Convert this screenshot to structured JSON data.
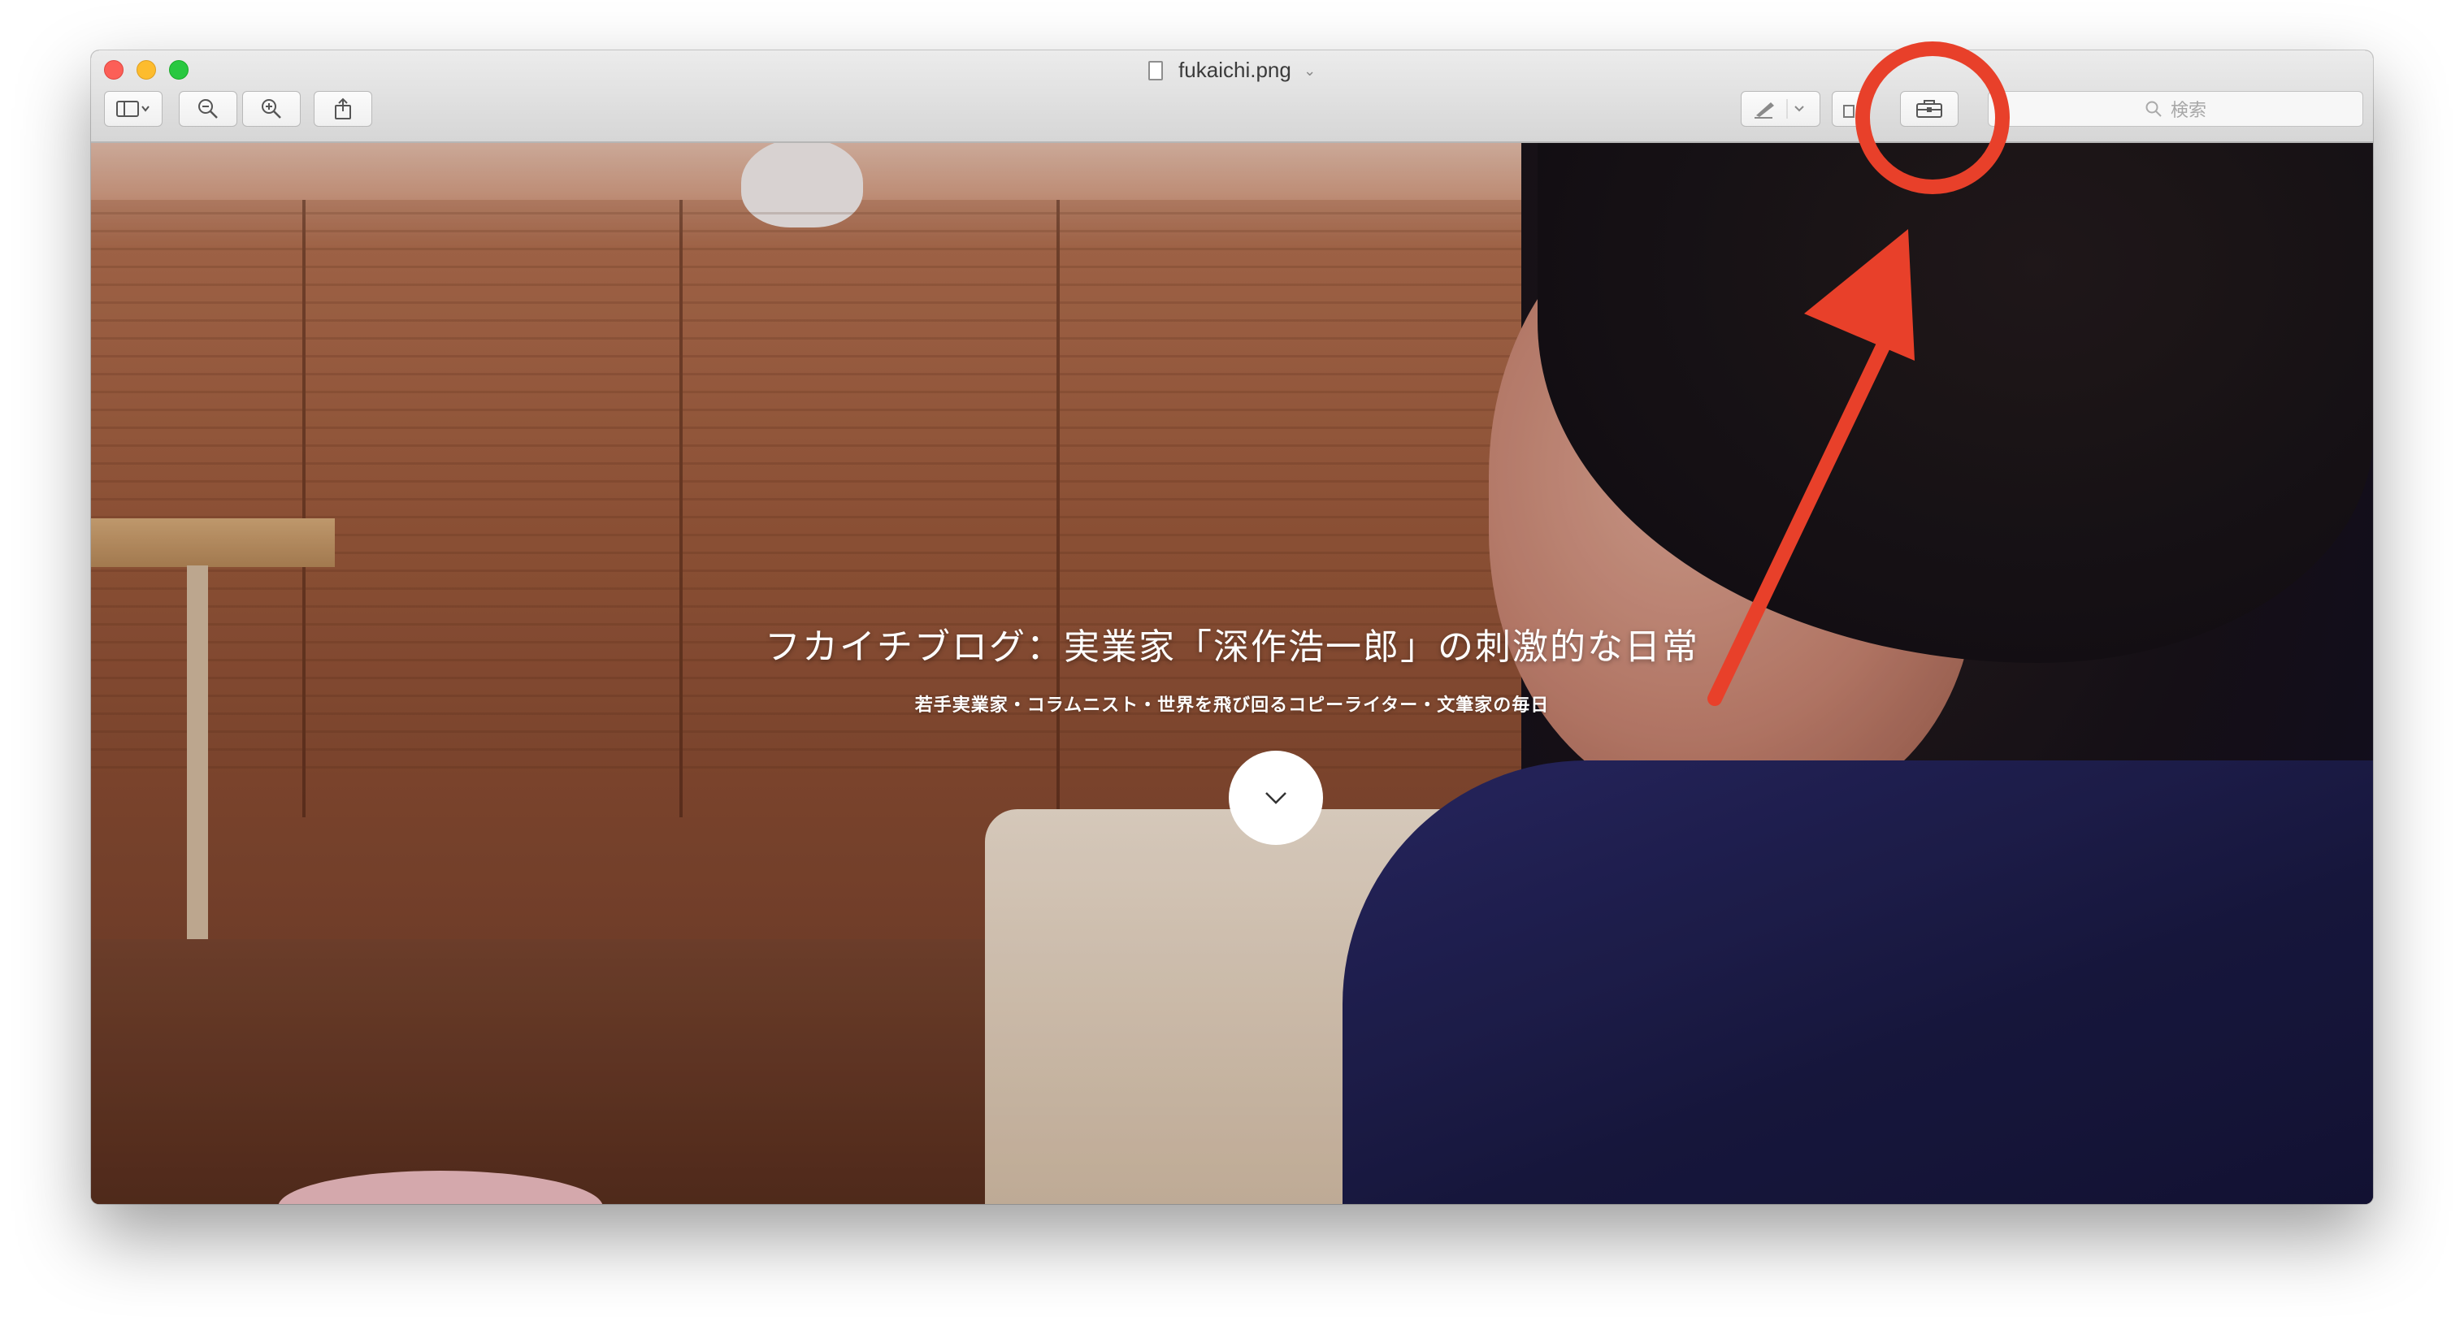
{
  "window": {
    "title": "fukaichi.png"
  },
  "toolbar": {
    "search_placeholder": "検索"
  },
  "hero": {
    "title": "フカイチブログ：実業家「深作浩一郎」の刺激的な日常",
    "subtitle": "若手実業家・コラムニスト・世界を飛び回るコピーライター・文筆家の毎日"
  },
  "annotation": {
    "color": "#e8402a"
  }
}
